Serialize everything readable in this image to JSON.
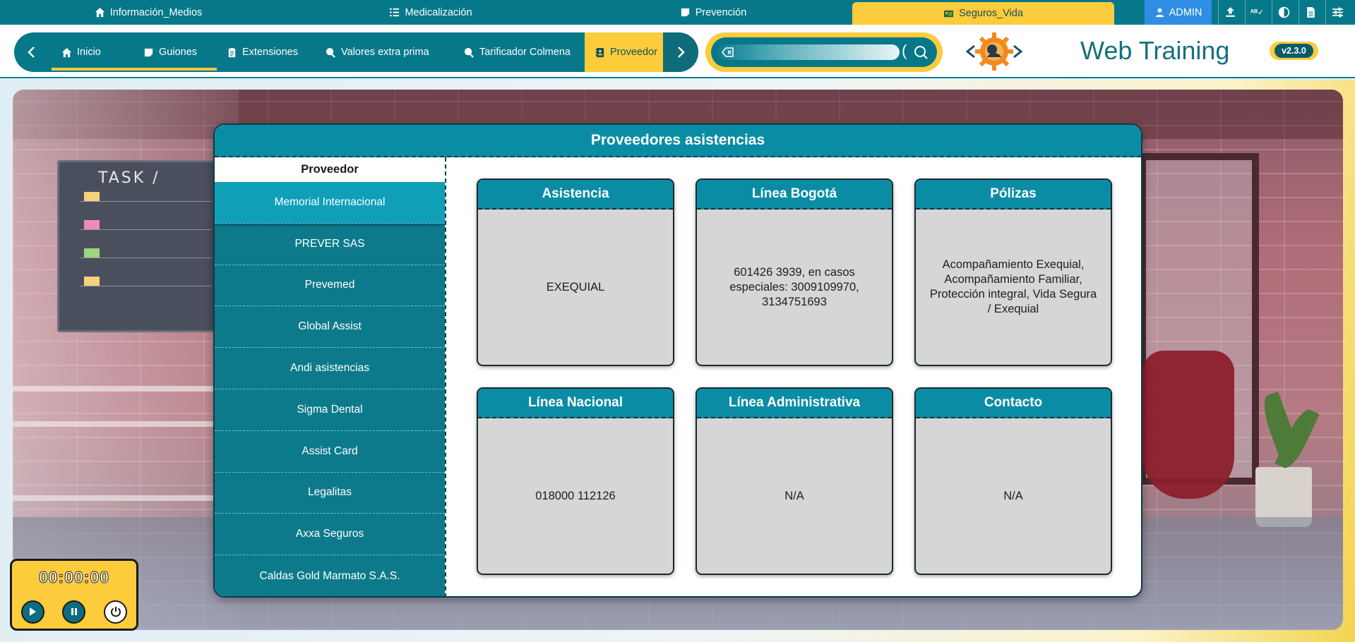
{
  "top_tabs": [
    {
      "label": "Información_Medios",
      "icon": "home-icon"
    },
    {
      "label": "Medicalización",
      "icon": "checklist-icon"
    },
    {
      "label": "Prevención",
      "icon": "note-icon"
    },
    {
      "label": "Seguros_Vida",
      "icon": "id-card-icon",
      "active": true
    }
  ],
  "admin": {
    "label": "ADMIN",
    "icon": "user-icon"
  },
  "top_icons": [
    "upload-icon",
    "spellcheck-icon",
    "contrast-icon",
    "document-icon",
    "settings-sliders-icon"
  ],
  "nav": {
    "items": [
      {
        "label": "Inicio",
        "icon": "home-icon"
      },
      {
        "label": "Guiones",
        "icon": "note-icon"
      },
      {
        "label": "Extensiones",
        "icon": "clipboard-icon"
      },
      {
        "label": "Valores extra prima",
        "icon": "search-dollar-icon"
      },
      {
        "label": "Tarificador Colmena",
        "icon": "search-dollar-icon"
      },
      {
        "label": "Proveedor",
        "icon": "contact-book-icon",
        "active": true
      }
    ]
  },
  "search": {
    "placeholder": "",
    "value": ""
  },
  "brand": {
    "title": "Web Training",
    "version": "v2.3.0"
  },
  "panel": {
    "title": "Proveedores asistencias",
    "sidebar_header": "Proveedor",
    "providers": [
      "Memorial Internacional",
      "PREVER SAS",
      "Prevemed",
      "Global Assist",
      "Andi asistencias",
      "Sigma Dental",
      "Assist Card",
      "Legalitas",
      "Axxa Seguros",
      "Caldas Gold Marmato S.A.S."
    ],
    "selected_provider": "Memorial Internacional",
    "cards": [
      {
        "title": "Asistencia",
        "value": "EXEQUIAL"
      },
      {
        "title": "Línea Bogotá",
        "value": "601426 3939, en casos especiales: 3009109970, 3134751693"
      },
      {
        "title": "Pólizas",
        "value": "Acompañamiento Exequial, Acompañamiento Familiar, Protección integral, Vida Segura / Exequial"
      },
      {
        "title": "Línea Nacional",
        "value": "018000 112126"
      },
      {
        "title": "Línea Administrativa",
        "value": "N/A"
      },
      {
        "title": "Contacto",
        "value": "N/A"
      }
    ]
  },
  "timer": {
    "display": "00:00:00"
  },
  "colors": {
    "teal": "#07788a",
    "accent": "#fccc3c",
    "card_header": "#0a8da4",
    "card_body": "#d6d6d6"
  }
}
